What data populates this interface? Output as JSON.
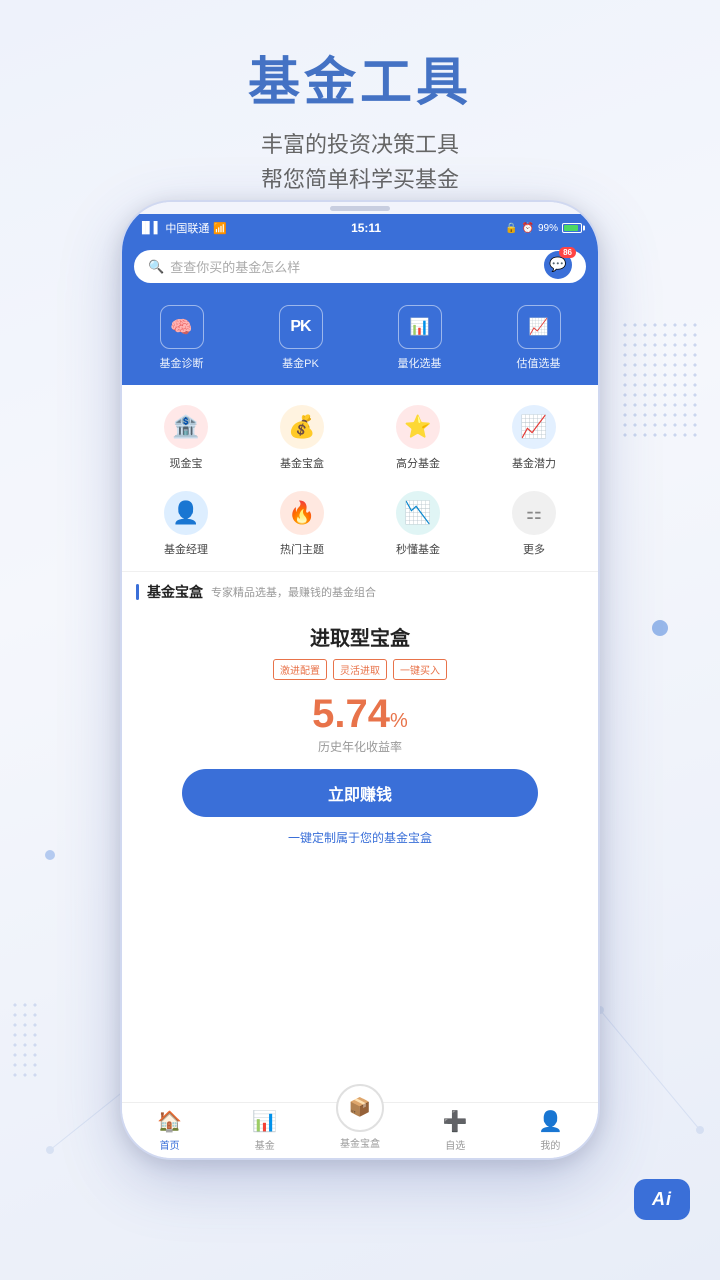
{
  "page": {
    "title": "基金工具",
    "subtitle_line1": "丰富的投资决策工具",
    "subtitle_line2": "帮您简单科学买基金"
  },
  "status_bar": {
    "carrier": "中国联通",
    "time": "15:11",
    "battery": "99%"
  },
  "search": {
    "placeholder": "查查你买的基金怎么样",
    "message_badge": "86"
  },
  "tools": [
    {
      "id": "diagnosis",
      "icon": "🧠",
      "label": "基金诊断"
    },
    {
      "id": "pk",
      "icon": "PK",
      "label": "基金PK"
    },
    {
      "id": "quantitative",
      "icon": "📊",
      "label": "量化选基"
    },
    {
      "id": "valuation",
      "icon": "📈",
      "label": "估值选基"
    }
  ],
  "quick_items": [
    {
      "id": "cash",
      "icon": "🏦",
      "color": "ic-pink",
      "label": "现金宝"
    },
    {
      "id": "box",
      "icon": "💰",
      "color": "ic-orange",
      "label": "基金宝盒"
    },
    {
      "id": "highscore",
      "icon": "⭐",
      "color": "ic-red",
      "label": "高分基金"
    },
    {
      "id": "potential",
      "icon": "📈",
      "color": "ic-blue",
      "label": "基金潜力"
    },
    {
      "id": "manager",
      "icon": "👤",
      "color": "ic-blue2",
      "label": "基金经理"
    },
    {
      "id": "hot",
      "icon": "🔥",
      "color": "ic-flame",
      "label": "热门主题"
    },
    {
      "id": "understand",
      "icon": "📉",
      "color": "ic-teal",
      "label": "秒懂基金"
    },
    {
      "id": "more",
      "icon": "⋯",
      "color": "ic-gray",
      "label": "更多"
    }
  ],
  "section": {
    "title": "基金宝盒",
    "subtitle": "专家精品选基，最赚钱的基金组合"
  },
  "fund_card": {
    "title": "进取型宝盒",
    "tags": [
      "激进配置",
      "灵活进取",
      "一键买入"
    ],
    "rate": "5.74",
    "rate_unit": "%",
    "rate_label": "历史年化收益率",
    "btn_label": "立即赚钱",
    "link_label": "一键定制属于您的基金宝盒"
  },
  "bottom_nav": [
    {
      "id": "home",
      "icon": "🏠",
      "label": "首页",
      "active": true
    },
    {
      "id": "fund",
      "icon": "📊",
      "label": "基金",
      "active": false
    },
    {
      "id": "fundbox",
      "icon": "📦",
      "label": "基金宝盒",
      "active": false,
      "center": true
    },
    {
      "id": "watchlist",
      "icon": "➕",
      "label": "自选",
      "active": false
    },
    {
      "id": "mine",
      "icon": "👤",
      "label": "我的",
      "active": false
    }
  ],
  "colors": {
    "primary": "#3a6fd8",
    "accent": "#e8734a",
    "white": "#ffffff"
  }
}
